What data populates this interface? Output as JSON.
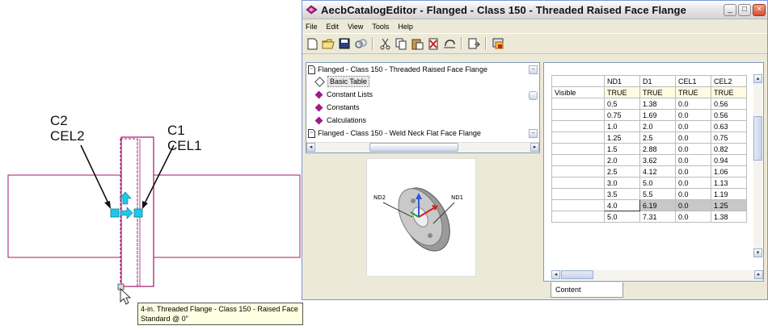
{
  "window": {
    "title": "AecbCatalogEditor - Flanged - Class 150 - Threaded Raised Face Flange",
    "min_glyph": "_",
    "max_glyph": "□",
    "close_glyph": "×"
  },
  "menu": [
    "File",
    "Edit",
    "View",
    "Tools",
    "Help"
  ],
  "toolbar_icons": [
    "new-icon",
    "open-icon",
    "save-icon",
    "link-icon",
    "cut-icon",
    "copy-icon",
    "paste-icon",
    "delete-icon",
    "undo-icon",
    "export-icon",
    "launch-icon"
  ],
  "tree": {
    "parent1": "Flanged - Class 150 - Threaded Raised Face Flange",
    "children": [
      "Basic Table",
      "Constant Lists",
      "Constants",
      "Calculations"
    ],
    "parent2": "Flanged - Class 150 - Weld Neck Flat Face Flange",
    "selected": "Basic Table"
  },
  "grid": {
    "columns": [
      "ND1",
      "D1",
      "CEL1",
      "CEL2"
    ],
    "visible_label": "Visible",
    "visible_row": [
      "TRUE",
      "TRUE",
      "TRUE",
      "TRUE"
    ],
    "rows": [
      [
        "0.5",
        "1.38",
        "0.0",
        "0.56"
      ],
      [
        "0.75",
        "1.69",
        "0.0",
        "0.56"
      ],
      [
        "1.0",
        "2.0",
        "0.0",
        "0.63"
      ],
      [
        "1.25",
        "2.5",
        "0.0",
        "0.75"
      ],
      [
        "1.5",
        "2.88",
        "0.0",
        "0.82"
      ],
      [
        "2.0",
        "3.62",
        "0.0",
        "0.94"
      ],
      [
        "2.5",
        "4.12",
        "0.0",
        "1.06"
      ],
      [
        "3.0",
        "5.0",
        "0.0",
        "1.13"
      ],
      [
        "3.5",
        "5.5",
        "0.0",
        "1.19"
      ],
      [
        "4.0",
        "6.19",
        "0.0",
        "1.25"
      ],
      [
        "5.0",
        "7.31",
        "0.0",
        "1.38"
      ]
    ],
    "highlight_row": 9
  },
  "tab": {
    "label": "Content"
  },
  "preview": {
    "nd2": "ND2",
    "nd1": "ND1"
  },
  "cad": {
    "label_c2": "C2",
    "label_cel2": "CEL2",
    "label_c1": "C1",
    "label_cel1": "CEL1",
    "tooltip_line1": "4-in. Threaded Flange - Class 150 - Raised Face",
    "tooltip_line2": "Standard @ 0\""
  },
  "colors": {
    "cad_line": "#a1196b",
    "connector": "#1ec8e8",
    "arrow": "#111111",
    "diamond": "#a0198e"
  }
}
